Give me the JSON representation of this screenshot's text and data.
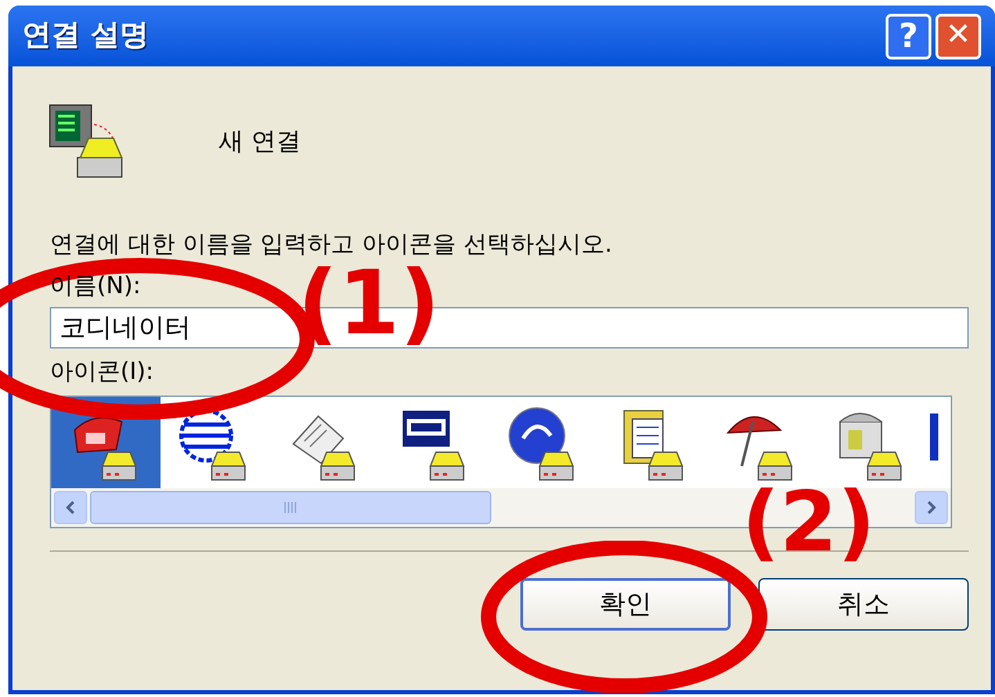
{
  "window": {
    "title": "연결 설명"
  },
  "title_buttons": [
    {
      "kind": "help",
      "label": "?"
    },
    {
      "kind": "close",
      "label": "✕"
    }
  ],
  "header": {
    "text": "새 연결"
  },
  "instruction": "연결에 대한 이름을 입력하고 아이콘을 선택하십시오.",
  "name_field": {
    "label": "이름(N):",
    "value": "코디네이터"
  },
  "icon_list": {
    "label": "아이콘(I):",
    "items": [
      {
        "selected": true
      },
      {
        "selected": false
      },
      {
        "selected": false
      },
      {
        "selected": false
      },
      {
        "selected": false
      },
      {
        "selected": false
      },
      {
        "selected": false
      },
      {
        "selected": false
      },
      {
        "selected": false
      }
    ]
  },
  "buttons": [
    {
      "label": "확인",
      "default": true
    },
    {
      "label": "취소",
      "default": false
    }
  ],
  "annotations": [
    {
      "label": "(1)"
    },
    {
      "label": "(2)"
    }
  ]
}
